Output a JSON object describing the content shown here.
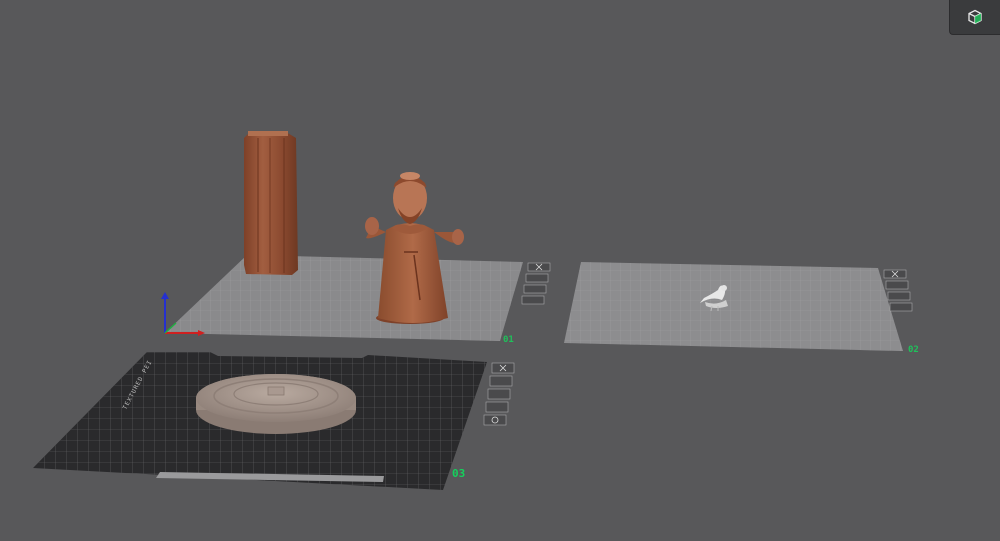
{
  "app": {
    "view": "3D prepare viewport"
  },
  "toolbar": {
    "view_cube_icon": "cube-icon",
    "accent": "#1fc15a"
  },
  "plates": [
    {
      "number": "01",
      "type": "smooth",
      "objects": [
        "pillar",
        "monk-figure"
      ]
    },
    {
      "number": "02",
      "type": "smooth",
      "objects": [
        "dove"
      ]
    },
    {
      "number": "03",
      "type": "textured-pei",
      "brand": "TEXTURED PEI",
      "objects": [
        "round-base"
      ]
    }
  ],
  "plate_tools": [
    "close-icon",
    "arrange-icon",
    "orient-icon",
    "lock-icon",
    "settings-icon"
  ],
  "colors": {
    "background": "#58585a",
    "model_brown": "#9b5a3a",
    "plate_grey": "#8d8d8f",
    "plate_dark": "#2a2a2c",
    "grid_green_x": "#d02020",
    "axis_blue": "#2530d0"
  }
}
